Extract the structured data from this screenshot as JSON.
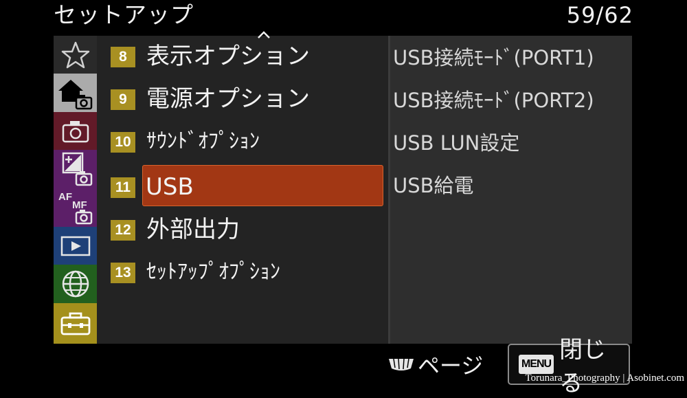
{
  "header": {
    "title": "セットアップ",
    "page_counter": "59/62"
  },
  "sidebar": {
    "tabs": [
      {
        "icon": "star-icon",
        "color": "#2a2a2a"
      },
      {
        "icon": "home-camera-icon",
        "color": "#ababab"
      },
      {
        "icon": "camera-icon",
        "color": "#621a28"
      },
      {
        "icon": "exposure-camera-icon",
        "color": "#5c1f68"
      },
      {
        "icon": "af-mf-camera-icon",
        "color": "#5c1f68",
        "text_af": "AF",
        "text_mf": "MF"
      },
      {
        "icon": "playback-icon",
        "color": "#1e4078"
      },
      {
        "icon": "globe-icon",
        "color": "#22601e"
      },
      {
        "icon": "toolbox-icon",
        "color": "#a4901c"
      }
    ]
  },
  "main_menu": {
    "items": [
      {
        "number": "8",
        "label": "表示オプション"
      },
      {
        "number": "9",
        "label": "電源オプション"
      },
      {
        "number": "10",
        "label": "ｻｳﾝﾄﾞｵﾌﾟｼｮﾝ"
      },
      {
        "number": "11",
        "label": "USB",
        "selected": true
      },
      {
        "number": "12",
        "label": "外部出力"
      },
      {
        "number": "13",
        "label": "ｾｯﾄｱｯﾌﾟｵﾌﾟｼｮﾝ"
      }
    ]
  },
  "submenu": {
    "items": [
      {
        "label": "USB接続ﾓｰﾄﾞ(PORT1)"
      },
      {
        "label": "USB接続ﾓｰﾄﾞ(PORT2)"
      },
      {
        "label": "USB LUN設定"
      },
      {
        "label": "USB給電"
      }
    ]
  },
  "footer": {
    "page_label": "ページ",
    "menu_key": "MENU",
    "close_label": "閉じる"
  },
  "watermark": "Torunara_Photography | Asobinet.com"
}
